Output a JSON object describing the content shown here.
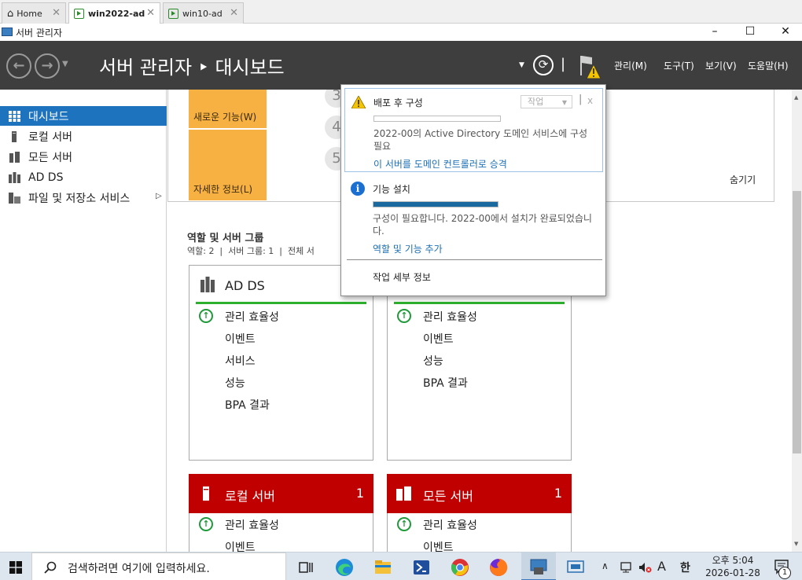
{
  "vm_tabs": [
    {
      "label": "Home"
    },
    {
      "label": "win2022-ad"
    },
    {
      "label": "win10-ad"
    }
  ],
  "window": {
    "title": "서버 관리자",
    "minimize": "–",
    "maximize": "☐",
    "close": "✕"
  },
  "header": {
    "title": "서버 관리자 ‣ 대시보드",
    "menu": [
      "관리(M)",
      "도구(T)",
      "보기(V)",
      "도움말(H)"
    ],
    "separator": "|"
  },
  "sidebar": {
    "items": [
      {
        "label": "대시보드"
      },
      {
        "label": "로컬 서버"
      },
      {
        "label": "모든 서버"
      },
      {
        "label": "AD DS"
      },
      {
        "label": "파일 및 저장소 서비스"
      }
    ],
    "expand_glyph": "▷"
  },
  "main": {
    "tile_new": "새로운 기능(W)",
    "tile_info": "자세한 정보(L)",
    "steps": [
      "3",
      "4",
      "5"
    ],
    "hide": "숨기기",
    "roles_heading": "역할 및 서버 그룹",
    "roles_summary": "역할: 2  |  서버 그룹: 1  |  전체 서",
    "cards": [
      {
        "title": "AD DS",
        "rows": [
          "관리 효율성",
          "이벤트",
          "서비스",
          "성능",
          "BPA 결과"
        ]
      },
      {
        "title": "",
        "rows": [
          "관리 효율성",
          "이벤트",
          "성능",
          "BPA 결과"
        ]
      }
    ],
    "red_cards": [
      {
        "title": "로컬 서버",
        "count": "1",
        "rows": [
          "관리 효율성",
          "이벤트"
        ]
      },
      {
        "title": "모든 서버",
        "count": "1",
        "rows": [
          "관리 효율성",
          "이벤트"
        ]
      }
    ]
  },
  "popup": {
    "deploy_title": "배포 후 구성",
    "task_dropdown": "작업",
    "close": "x",
    "deploy_text": "2022-00의 Active Directory 도메인 서비스에 구성 필요",
    "deploy_link": "이 서버를 도메인 컨트롤러로 승격",
    "install_title": "기능 설치",
    "install_progress": 1.0,
    "install_text": "구성이 필요합니다. 2022-00에서 설치가 완료되었습니다.",
    "install_link": "역할 및 기능 추가",
    "details": "작업 세부 정보"
  },
  "taskbar": {
    "search_placeholder": "검색하려면 여기에 입력하세요.",
    "time": "오후 5:04",
    "date": "2026-01-28",
    "ime_a": "A",
    "ime_han": "한",
    "notif_count": "1"
  },
  "colors": {
    "header_bg": "#3e3e3e",
    "selected": "#1e73be",
    "tile": "#f7b142",
    "red": "#c00000",
    "green": "#2db02d",
    "link": "#1a6fb5"
  }
}
